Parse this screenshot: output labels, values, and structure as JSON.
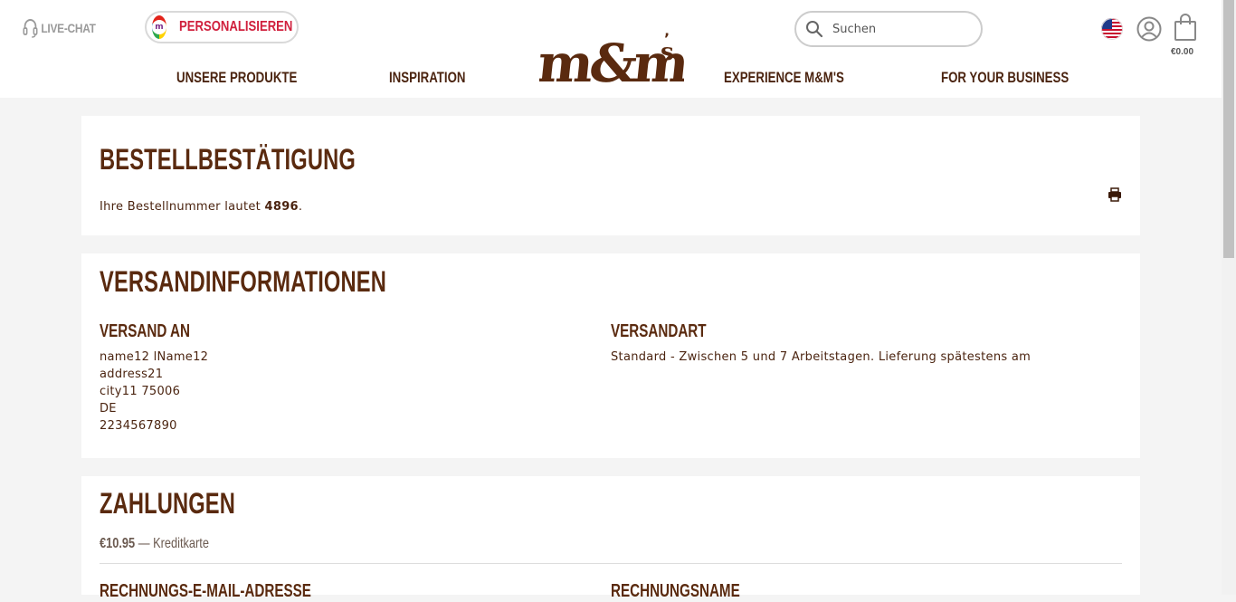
{
  "header": {
    "live_chat": "LIVE-CHAT",
    "personalize": "PERSONALISIEREN",
    "search_placeholder": "Suchen",
    "cart_total": "€0.00",
    "logo_alt": "m&m's",
    "nav": [
      {
        "label": "UNSERE PRODUKTE"
      },
      {
        "label": "INSPIRATION"
      },
      {
        "label": "EXPERIENCE M&M'S"
      },
      {
        "label": "FOR YOUR BUSINESS"
      }
    ]
  },
  "confirmation": {
    "title": "BESTELLBESTÄTIGUNG",
    "order_text_prefix": "Ihre Bestellnummer lautet ",
    "order_number": "4896",
    "order_text_suffix": "."
  },
  "shipping": {
    "title": "VERSANDINFORMATIONEN",
    "ship_to_label": "VERSAND AN",
    "address": [
      "name12 lName12",
      "address21",
      "city11 75006",
      "DE",
      "2234567890"
    ],
    "method_label": "VERSANDART",
    "method_value": "Standard - Zwischen 5 und 7 Arbeitstagen. Lieferung spätestens am"
  },
  "payments": {
    "title": "ZAHLUNGEN",
    "amount": "€10.95",
    "separator": " — ",
    "method": "Kreditkarte",
    "billing_email_label": "RECHNUNGS-E-MAIL-ADRESSE",
    "billing_name_label": "RECHNUNGSNAME"
  },
  "colors": {
    "brand_brown": "#5a2a0f",
    "accent_red": "#d01f3c",
    "background": "#f4f4f4"
  }
}
